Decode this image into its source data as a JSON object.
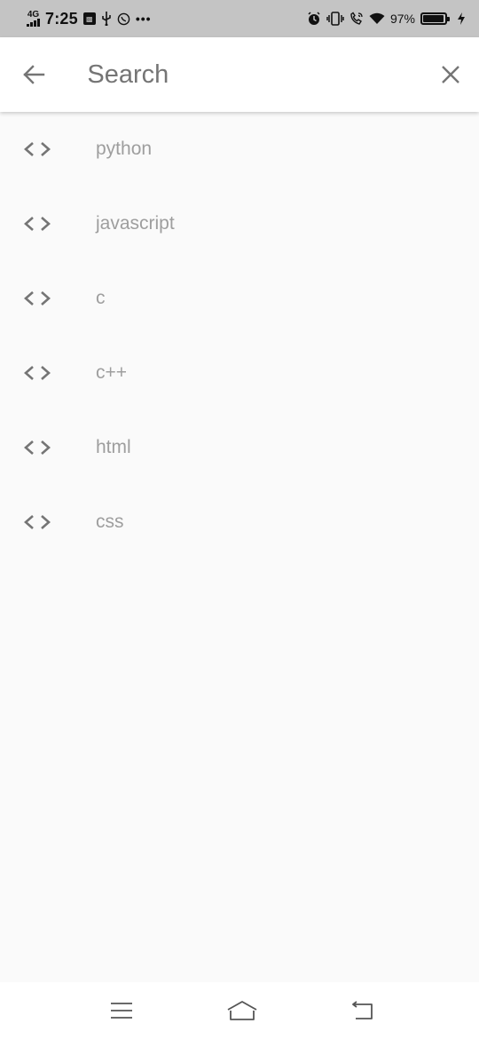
{
  "status_bar": {
    "network": "4G",
    "time": "7:25",
    "battery_percent": "97%",
    "icons": [
      "network-signal-icon",
      "notification-box-icon",
      "usb-icon",
      "whatsapp-icon",
      "more-dots-icon",
      "alarm-icon",
      "vibrate-icon",
      "wifi-call-icon",
      "wifi-icon",
      "battery-icon",
      "charging-icon"
    ]
  },
  "search": {
    "placeholder": "Search",
    "value": "",
    "back_icon": "arrow-left-icon",
    "clear_icon": "close-icon",
    "caret_color": "#3f51b5"
  },
  "results": [
    {
      "label": "python",
      "icon": "code-brackets-icon"
    },
    {
      "label": "javascript",
      "icon": "code-brackets-icon"
    },
    {
      "label": "c",
      "icon": "code-brackets-icon"
    },
    {
      "label": "c++",
      "icon": "code-brackets-icon"
    },
    {
      "label": "html",
      "icon": "code-brackets-icon"
    },
    {
      "label": "css",
      "icon": "code-brackets-icon"
    }
  ],
  "nav_bar": {
    "icons": [
      "menu-icon",
      "home-icon",
      "back-icon"
    ]
  }
}
